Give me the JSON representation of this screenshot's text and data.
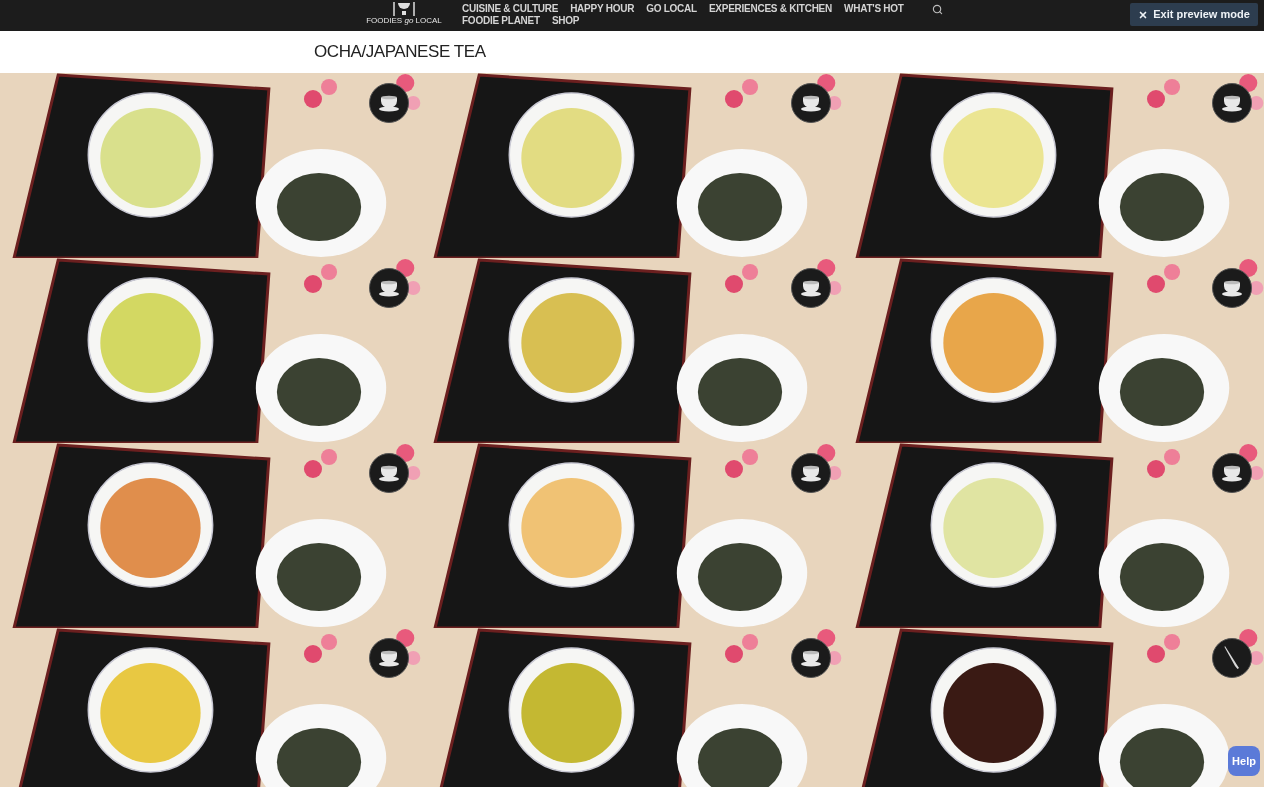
{
  "header": {
    "logo": "FOODIES *go* LOCAL",
    "nav": [
      "CUISINE & CULTURE",
      "HAPPY HOUR",
      "GO LOCAL",
      "EXPERIENCES & KITCHEN",
      "WHAT'S HOT",
      "FOODIE PLANET",
      "SHOP"
    ],
    "exit_button": "Exit preview mode"
  },
  "page_title": "OCHA/JAPANESE TEA",
  "tiles": [
    {
      "kind": "cup",
      "color": "#d9e08c"
    },
    {
      "kind": "cup",
      "color": "#e2dc82"
    },
    {
      "kind": "cup",
      "color": "#ebe592"
    },
    {
      "kind": "cup",
      "color": "#d3d862"
    },
    {
      "kind": "cup",
      "color": "#d8bf52"
    },
    {
      "kind": "cup",
      "color": "#e8a64a"
    },
    {
      "kind": "cup",
      "color": "#e08e4c"
    },
    {
      "kind": "cup",
      "color": "#f0c274"
    },
    {
      "kind": "cup",
      "color": "#e0e4a2"
    },
    {
      "kind": "cup",
      "color": "#e8c842"
    },
    {
      "kind": "cup",
      "color": "#c4b832"
    },
    {
      "kind": "knife",
      "color": "#3a1a14"
    }
  ],
  "help_button": "Help"
}
